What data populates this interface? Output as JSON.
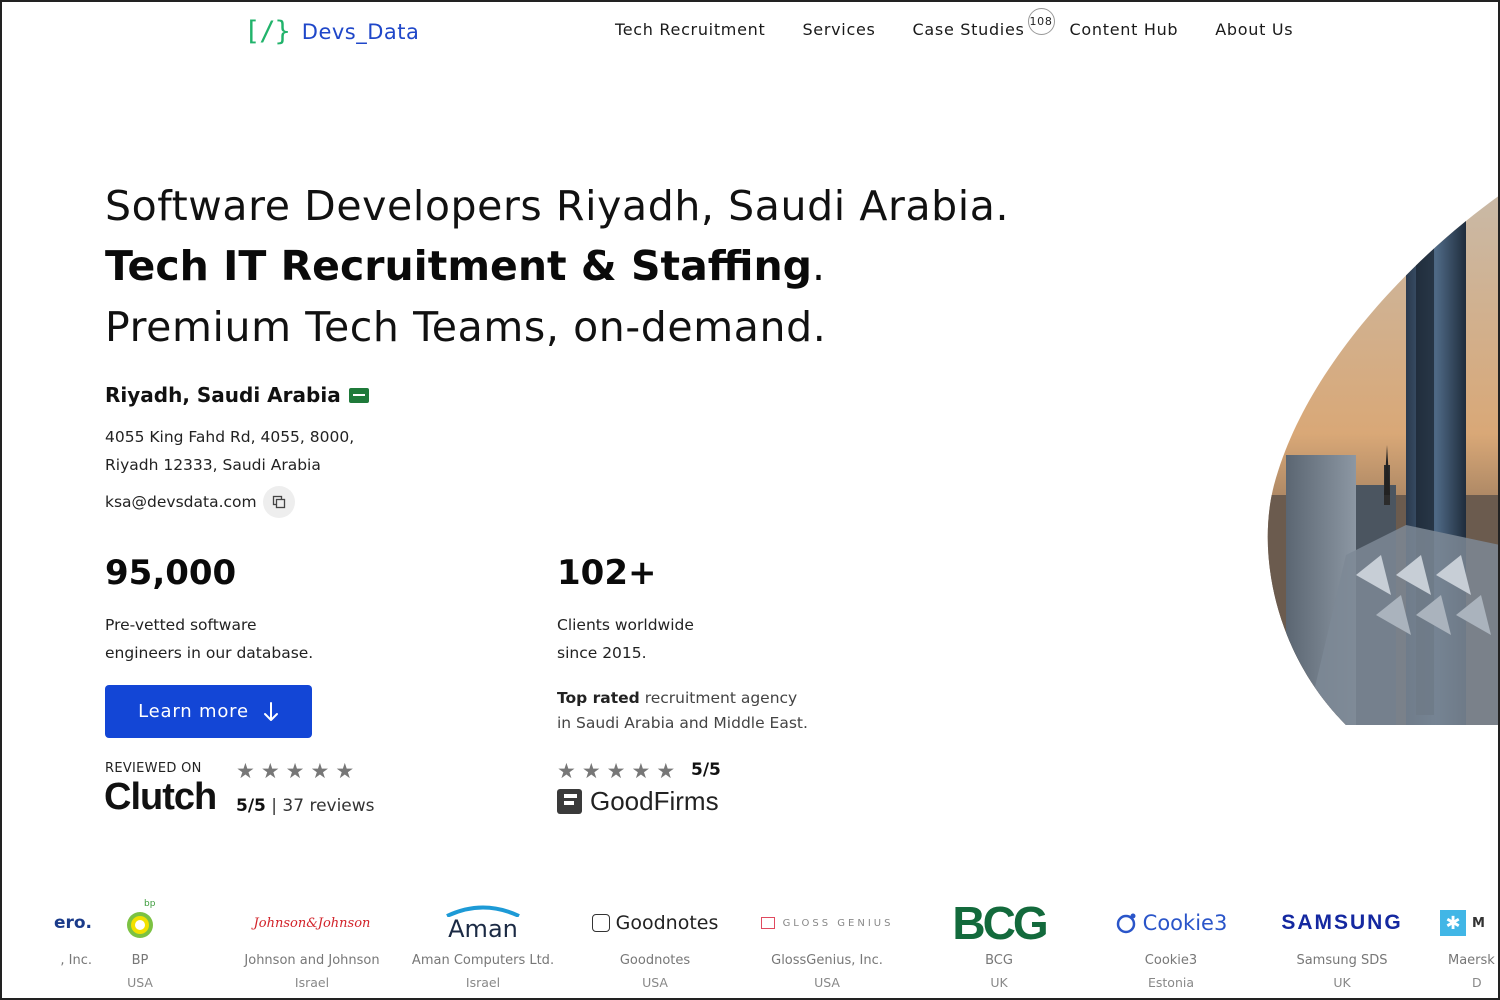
{
  "header": {
    "logo_mark": "[/}",
    "logo_text": "Devs_Data",
    "nav": [
      {
        "label": "Tech Recruitment"
      },
      {
        "label": "Services"
      },
      {
        "label": "Case Studies",
        "badge": "108"
      },
      {
        "label": "Content Hub"
      },
      {
        "label": "About Us"
      }
    ]
  },
  "hero": {
    "line1": "Software Developers Riyadh, Saudi Arabia.",
    "line2": "Tech IT Recruitment & Staffing",
    "line2_suffix": ".",
    "line3": "Premium Tech Teams, on-demand."
  },
  "location": {
    "title": "Riyadh, Saudi Arabia",
    "address_line1": "4055 King Fahd Rd, 4055, 8000,",
    "address_line2": "Riyadh 12333, Saudi Arabia",
    "email": "ksa@devsdata.com"
  },
  "stats": [
    {
      "value": "95,000",
      "desc_line1": "Pre-vetted software",
      "desc_line2": "engineers in our database."
    },
    {
      "value": "102+",
      "desc_line1": "Clients worldwide",
      "desc_line2": "since 2015."
    }
  ],
  "cta": {
    "label": "Learn more"
  },
  "clutch": {
    "reviewed_on": "REVIEWED ON",
    "brand": "Clutch",
    "score": "5/5",
    "reviews": "| 37 reviews",
    "stars": 5
  },
  "goodfirms": {
    "top_rated_bold": "Top rated",
    "top_rated_rest": " recruitment agency",
    "line2": "in Saudi Arabia and Middle East.",
    "score": "5/5",
    "brand": "GoodFirms",
    "stars": 5
  },
  "clients": [
    {
      "logo": "ero.",
      "name": ", Inc.",
      "country": ""
    },
    {
      "logo": "bp",
      "name": "BP",
      "country": "USA"
    },
    {
      "logo": "Johnson&Johnson",
      "name": "Johnson and Johnson",
      "country": "Israel"
    },
    {
      "logo": "Aman",
      "name": "Aman Computers Ltd.",
      "country": "Israel"
    },
    {
      "logo": "Goodnotes",
      "name": "Goodnotes",
      "country": "USA"
    },
    {
      "logo": "GLOSS GENIUS",
      "name": "GlossGenius, Inc.",
      "country": "USA"
    },
    {
      "logo": "BCG",
      "name": "BCG",
      "country": "UK"
    },
    {
      "logo": "Cookie3",
      "name": "Cookie3",
      "country": "Estonia"
    },
    {
      "logo": "SAMSUNG",
      "name": "Samsung SDS",
      "country": "UK"
    },
    {
      "logo": "M",
      "name": "Maersk",
      "country": "D"
    }
  ],
  "colors": {
    "brand_blue": "#1346d6",
    "logo_green": "#21b36b",
    "logo_blue": "#1f47c9"
  }
}
